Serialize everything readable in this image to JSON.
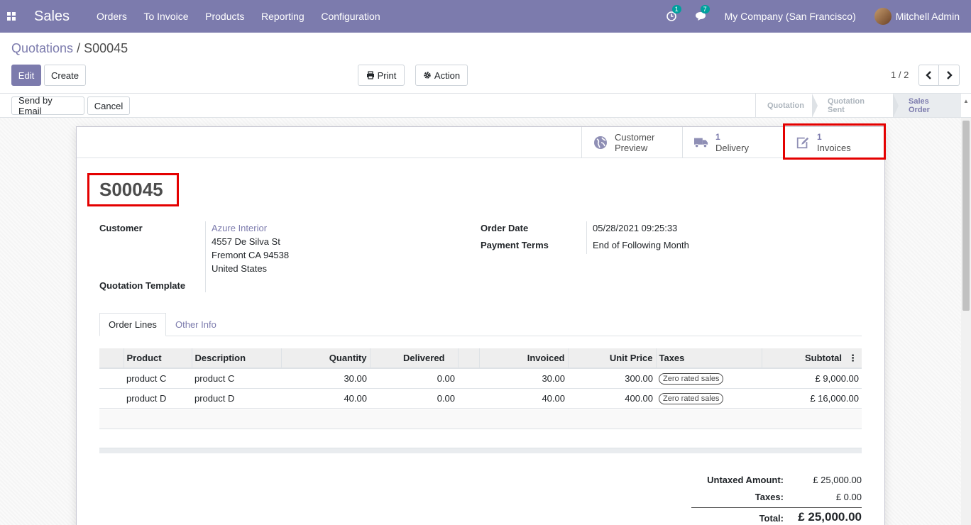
{
  "navbar": {
    "app_name": "Sales",
    "menu": [
      "Orders",
      "To Invoice",
      "Products",
      "Reporting",
      "Configuration"
    ],
    "activity_count": "1",
    "message_count": "7",
    "company": "My Company (San Francisco)",
    "user": "Mitchell Admin"
  },
  "breadcrumb": {
    "parent": "Quotations",
    "separator": "/",
    "current": "S00045"
  },
  "toolbar": {
    "edit": "Edit",
    "create": "Create",
    "print": "Print",
    "action": "Action"
  },
  "pager": {
    "value": "1 / 2"
  },
  "statusbar": {
    "buttons": {
      "send_email": "Send by Email",
      "cancel": "Cancel"
    },
    "steps": [
      "Quotation",
      "Quotation Sent",
      "Sales Order"
    ],
    "active_step": "Sales Order"
  },
  "smart_buttons": {
    "preview": {
      "line1": "Customer",
      "line2": "Preview"
    },
    "delivery": {
      "count": "1",
      "label": "Delivery"
    },
    "invoices": {
      "count": "1",
      "label": "Invoices"
    }
  },
  "order": {
    "name": "S00045",
    "customer_label": "Customer",
    "customer_name": "Azure Interior",
    "address_line1": "4557 De Silva St",
    "address_line2": "Fremont CA 94538",
    "address_line3": "United States",
    "template_label": "Quotation Template",
    "order_date_label": "Order Date",
    "order_date": "05/28/2021 09:25:33",
    "payment_terms_label": "Payment Terms",
    "payment_terms": "End of Following Month"
  },
  "tabs": {
    "order_lines": "Order Lines",
    "other_info": "Other Info"
  },
  "lines_table": {
    "headers": {
      "product": "Product",
      "description": "Description",
      "quantity": "Quantity",
      "delivered": "Delivered",
      "invoiced": "Invoiced",
      "unit_price": "Unit Price",
      "taxes": "Taxes",
      "subtotal": "Subtotal"
    },
    "rows": [
      {
        "product": "product C",
        "description": "product C",
        "quantity": "30.00",
        "delivered": "0.00",
        "invoiced": "30.00",
        "unit_price": "300.00",
        "tax": "Zero rated sales",
        "subtotal": "£ 9,000.00"
      },
      {
        "product": "product D",
        "description": "product D",
        "quantity": "40.00",
        "delivered": "0.00",
        "invoiced": "40.00",
        "unit_price": "400.00",
        "tax": "Zero rated sales",
        "subtotal": "£ 16,000.00"
      }
    ]
  },
  "totals": {
    "untaxed_label": "Untaxed Amount:",
    "untaxed": "£ 25,000.00",
    "taxes_label": "Taxes:",
    "taxes": "£ 0.00",
    "total_label": "Total:",
    "total": "£ 25,000.00"
  }
}
